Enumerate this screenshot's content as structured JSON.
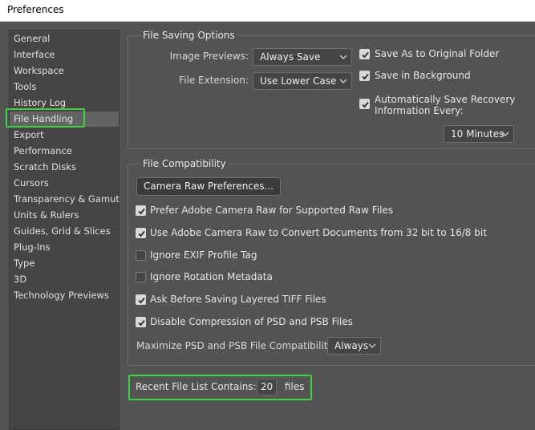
{
  "window": {
    "title": "Preferences"
  },
  "sidebar": {
    "items": [
      {
        "label": "General"
      },
      {
        "label": "Interface"
      },
      {
        "label": "Workspace"
      },
      {
        "label": "Tools"
      },
      {
        "label": "History Log"
      },
      {
        "label": "File Handling"
      },
      {
        "label": "Export"
      },
      {
        "label": "Performance"
      },
      {
        "label": "Scratch Disks"
      },
      {
        "label": "Cursors"
      },
      {
        "label": "Transparency & Gamut"
      },
      {
        "label": "Units & Rulers"
      },
      {
        "label": "Guides, Grid & Slices"
      },
      {
        "label": "Plug-Ins"
      },
      {
        "label": "Type"
      },
      {
        "label": "3D"
      },
      {
        "label": "Technology Previews"
      }
    ],
    "selected": "File Handling"
  },
  "file_saving": {
    "title": "File Saving Options",
    "image_previews_label": "Image Previews:",
    "image_previews_value": "Always Save",
    "file_extension_label": "File Extension:",
    "file_extension_value": "Use Lower Case",
    "save_as_original_label": "Save As to Original Folder",
    "save_as_original_checked": true,
    "save_in_background_label": "Save in Background",
    "save_in_background_checked": true,
    "auto_save_label_1": "Automatically Save Recovery",
    "auto_save_label_2": "Information Every:",
    "auto_save_checked": true,
    "auto_save_interval": "10 Minutes"
  },
  "file_compat": {
    "title": "File Compatibility",
    "camera_raw_button": "Camera Raw Preferences...",
    "options": [
      {
        "label": "Prefer Adobe Camera Raw for Supported Raw Files",
        "checked": true
      },
      {
        "label": "Use Adobe Camera Raw to Convert Documents from 32 bit to 16/8 bit",
        "checked": true
      },
      {
        "label": "Ignore EXIF Profile Tag",
        "checked": false
      },
      {
        "label": "Ignore Rotation Metadata",
        "checked": false
      },
      {
        "label": "Ask Before Saving Layered TIFF Files",
        "checked": true
      },
      {
        "label": "Disable Compression of PSD and PSB Files",
        "checked": true
      }
    ],
    "maximize_label": "Maximize PSD and PSB File Compatibility:",
    "maximize_value": "Always"
  },
  "recent": {
    "label": "Recent File List Contains:",
    "value": "20",
    "suffix": "files"
  },
  "colors": {
    "highlight": "#3fd23f",
    "panel_bg": "#535353",
    "sidebar_bg": "#454545"
  }
}
